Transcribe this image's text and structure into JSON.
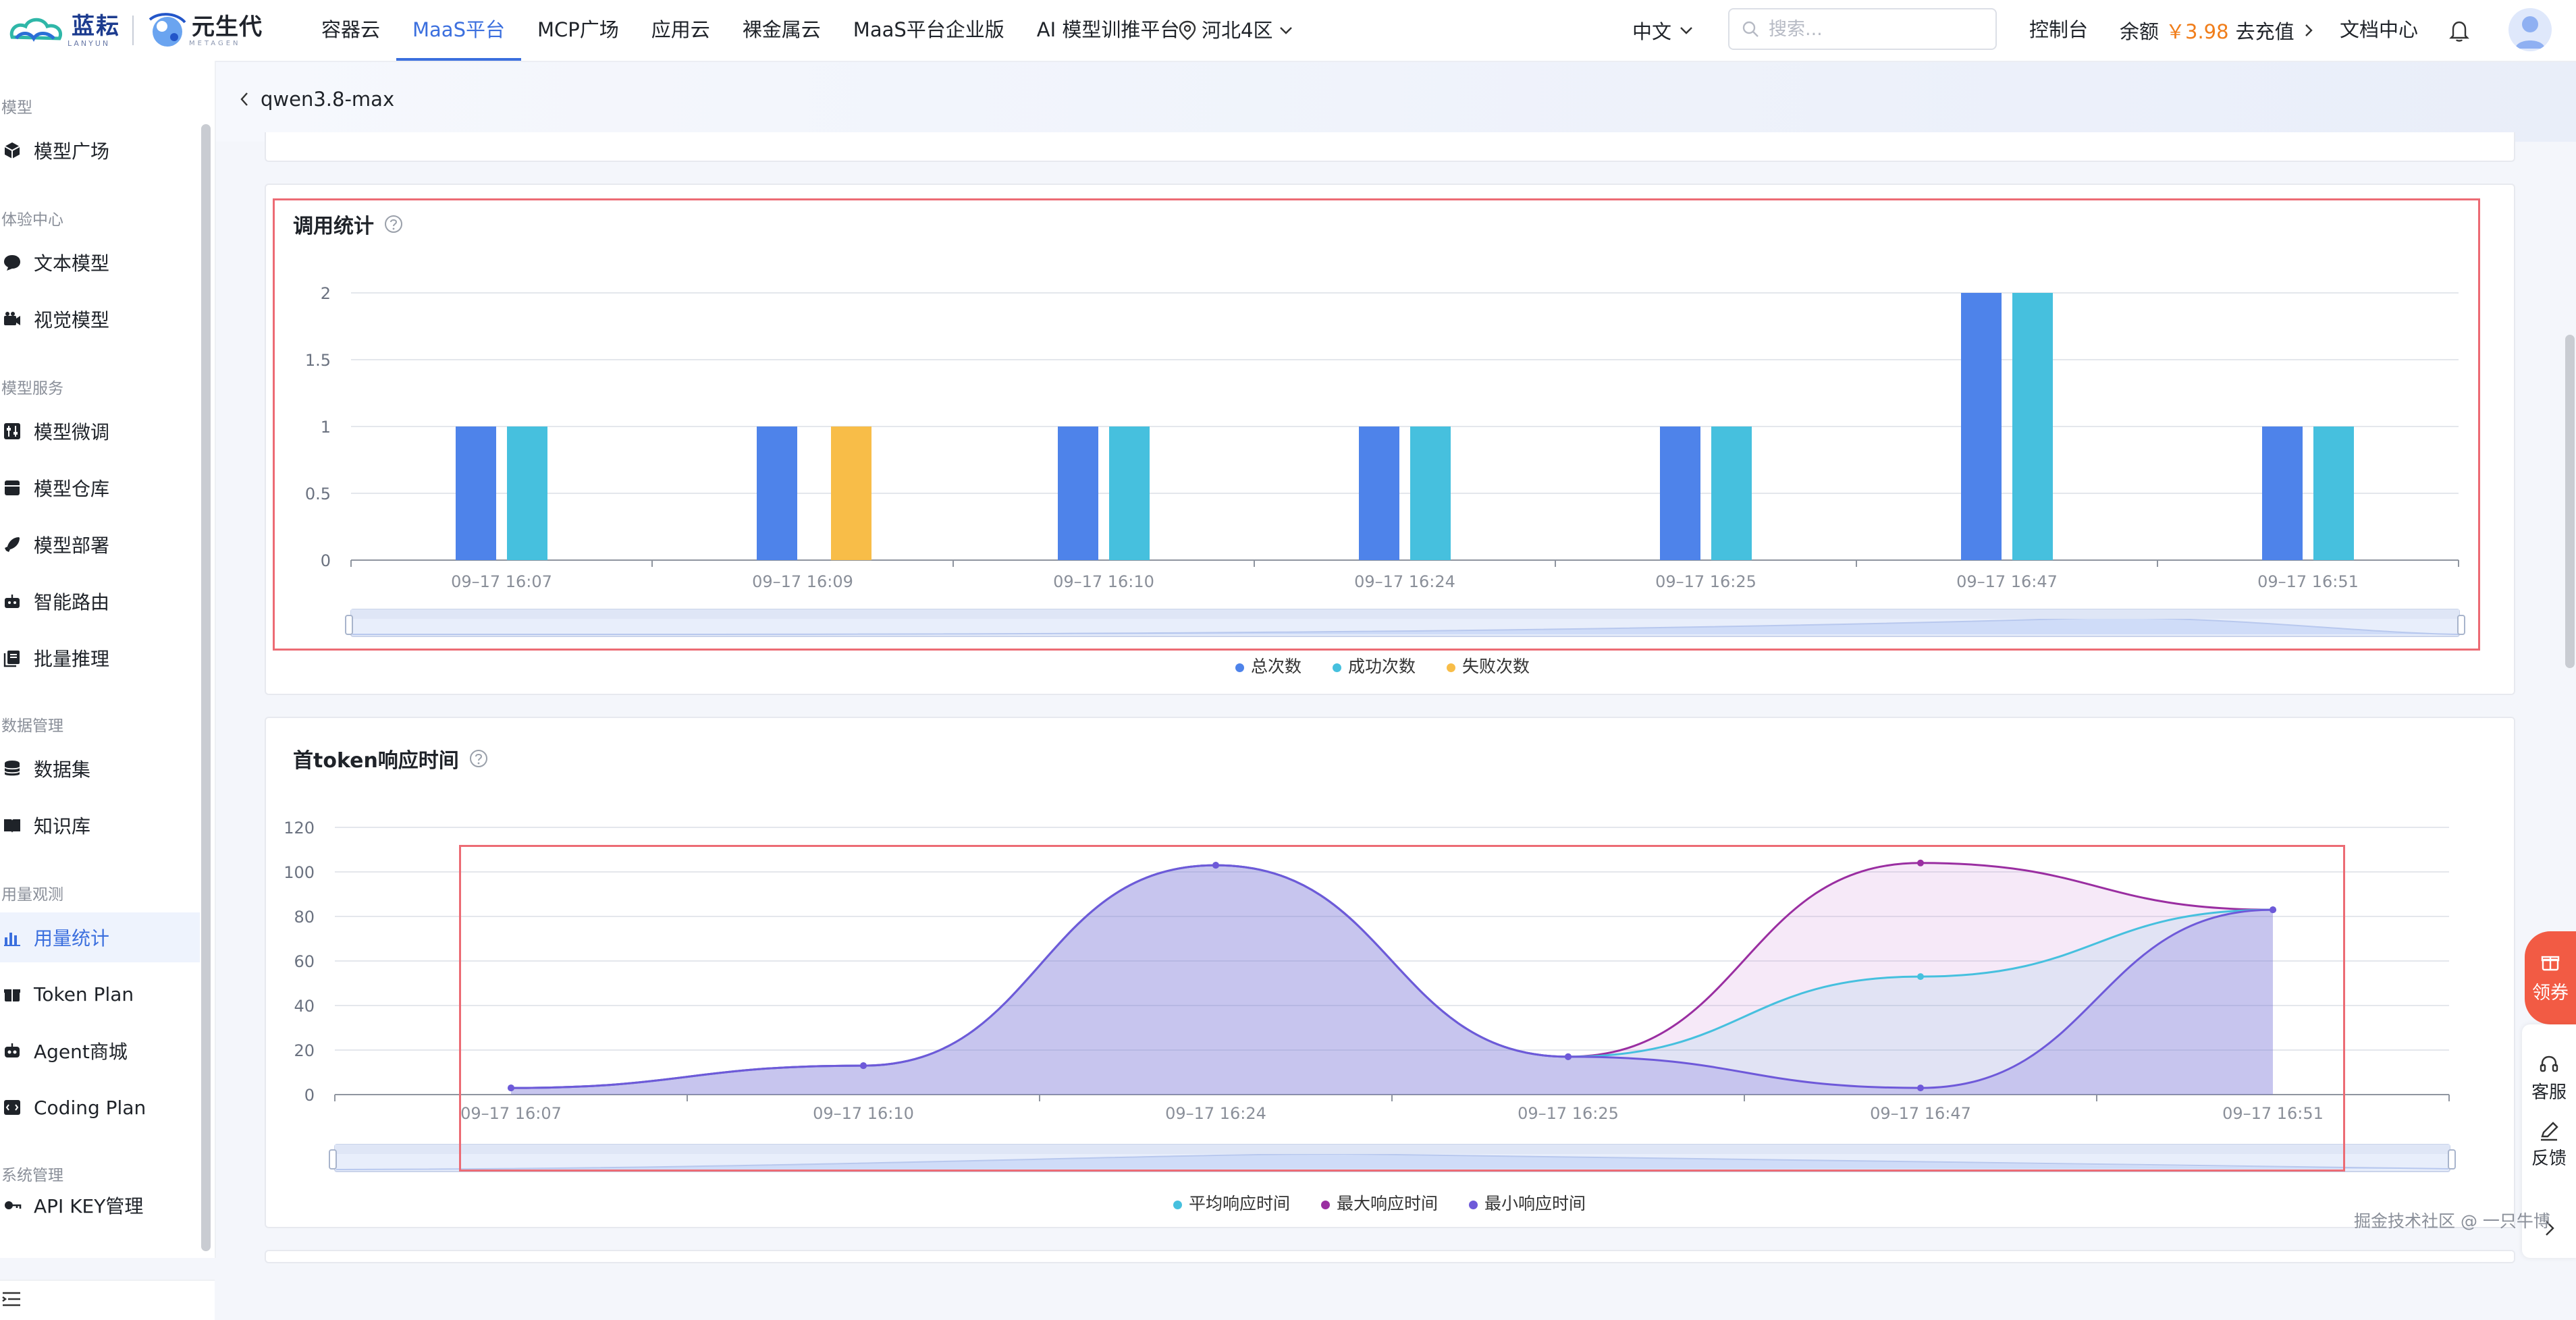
{
  "brand": {
    "name_a": "蓝耘",
    "sub_a": "LANYUN",
    "name_b": "元生代",
    "sub_b": "METAGEN"
  },
  "nav": {
    "items": [
      "容器云",
      "MaaS平台",
      "MCP广场",
      "应用云",
      "裸金属云",
      "MaaS平台企业版",
      "AI 模型训推平台"
    ],
    "active_index": 1,
    "region": "河北4区",
    "language": "中文",
    "search_placeholder": "搜索...",
    "console": "控制台",
    "balance_label": "余额",
    "balance_amount": "￥3.98",
    "recharge": "去充值",
    "docs": "文档中心",
    "icons": {
      "location": "location-pin-icon",
      "bell": "bell-icon",
      "search": "search-icon"
    }
  },
  "sidebar": {
    "groups": [
      {
        "title": "模型",
        "items": [
          {
            "label": "模型广场",
            "icon": "cube-icon"
          }
        ]
      },
      {
        "title": "体验中心",
        "items": [
          {
            "label": "文本模型",
            "icon": "chat-icon"
          },
          {
            "label": "视觉模型",
            "icon": "camera-icon"
          }
        ]
      },
      {
        "title": "模型服务",
        "items": [
          {
            "label": "模型微调",
            "icon": "tune-icon"
          },
          {
            "label": "模型仓库",
            "icon": "archive-icon"
          },
          {
            "label": "模型部署",
            "icon": "rocket-icon"
          },
          {
            "label": "智能路由",
            "icon": "robot-icon"
          },
          {
            "label": "批量推理",
            "icon": "batch-icon"
          }
        ]
      },
      {
        "title": "数据管理",
        "items": [
          {
            "label": "数据集",
            "icon": "database-icon"
          },
          {
            "label": "知识库",
            "icon": "book-icon"
          }
        ]
      },
      {
        "title": "用量观测",
        "items": [
          {
            "label": "用量统计",
            "icon": "bar-chart-icon",
            "active": true
          },
          {
            "label": "Token Plan",
            "icon": "gift-icon"
          },
          {
            "label": "Agent商城",
            "icon": "agent-icon"
          },
          {
            "label": "Coding Plan",
            "icon": "code-icon"
          }
        ]
      },
      {
        "title": "系统管理",
        "items": [
          {
            "label": "API KEY管理",
            "icon": "key-icon"
          }
        ]
      }
    ]
  },
  "page": {
    "title": "qwen3.8-max"
  },
  "cards": {
    "call_stats": {
      "title": "调用统计"
    },
    "ttft": {
      "title": "首token响应时间"
    }
  },
  "chart_data": [
    {
      "type": "bar",
      "title": "调用统计",
      "categories": [
        "09–17 16:07",
        "09–17 16:09",
        "09–17 16:10",
        "09–17 16:24",
        "09–17 16:25",
        "09–17 16:47",
        "09–17 16:51"
      ],
      "series": [
        {
          "name": "总次数",
          "values": [
            1,
            1,
            1,
            1,
            1,
            2,
            1
          ],
          "color": "#4e83ea"
        },
        {
          "name": "成功次数",
          "values": [
            1,
            0,
            1,
            1,
            1,
            2,
            1
          ],
          "color": "#46c0de"
        },
        {
          "name": "失败次数",
          "values": [
            0,
            1,
            0,
            0,
            0,
            0,
            0
          ],
          "color": "#f8bd48"
        }
      ],
      "ylim": [
        0,
        2
      ],
      "yticks": [
        0,
        0.5,
        1,
        1.5,
        2
      ],
      "grid": true,
      "legend": "bottom"
    },
    {
      "type": "area",
      "title": "首token响应时间",
      "categories": [
        "09–17 16:07",
        "09–17 16:10",
        "09–17 16:24",
        "09–17 16:25",
        "09–17 16:47",
        "09–17 16:51"
      ],
      "series": [
        {
          "name": "平均响应时间",
          "values": [
            3,
            13,
            103,
            17,
            53,
            83
          ],
          "color": "#46c0de"
        },
        {
          "name": "最大响应时间",
          "values": [
            3,
            13,
            103,
            17,
            104,
            83
          ],
          "color": "#9a2ea1"
        },
        {
          "name": "最小响应时间",
          "values": [
            3,
            13,
            103,
            17,
            3,
            83
          ],
          "color": "#6e59d9"
        }
      ],
      "ylim": [
        0,
        120
      ],
      "yticks": [
        0,
        20,
        40,
        60,
        80,
        100,
        120
      ],
      "grid": true,
      "legend": "bottom"
    }
  ],
  "floating": {
    "coupon": "领券",
    "service": "客服",
    "feedback": "反馈"
  },
  "watermark": "掘金技术社区 @ 一只牛博"
}
